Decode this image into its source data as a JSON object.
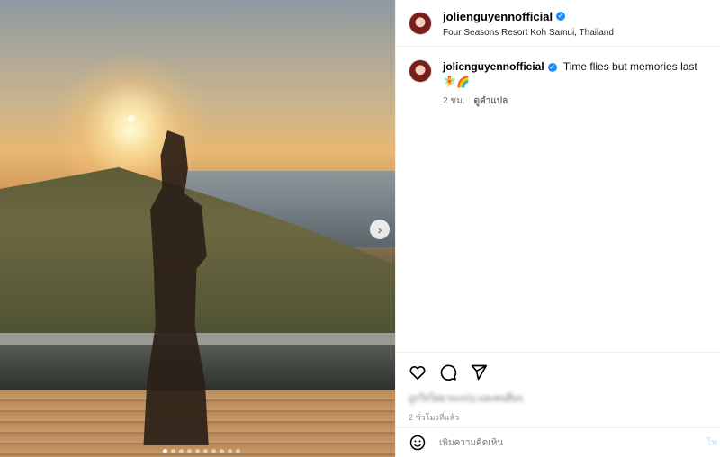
{
  "post": {
    "username": "jolienguyennofficial",
    "location": "Four Seasons Resort Koh Samui, Thailand",
    "caption": "Time flies but memories last 🧚🌈",
    "caption_age": "2 ชม.",
    "translate_label": "ดูคำแปล",
    "likes_text": "ถูกใจโดย twoii1j และคนอื่นๆ",
    "posted_time": "2 ชั่วโมงที่แล้ว",
    "comment_placeholder": "เพิ่มความคิดเห็น",
    "post_label": "โพ",
    "carousel": {
      "total": 10,
      "active_index": 0
    }
  },
  "icons": {
    "verified": "verified-badge-icon",
    "like": "heart-icon",
    "comment": "comment-bubble-icon",
    "share": "paper-plane-icon",
    "emoji": "emoji-smile-icon",
    "next": "chevron-right-icon"
  },
  "colors": {
    "verified": "#1e8ef5",
    "muted_text": "#737373"
  }
}
